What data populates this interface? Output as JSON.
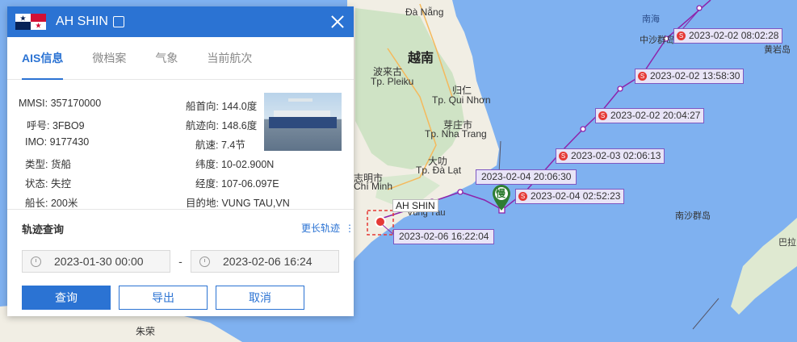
{
  "map": {
    "place_labels": [
      "Đà Nẵng",
      "越南",
      "波来古",
      "Tp. Pleiku",
      "归仁",
      "Tp. Qui Nhơn",
      "芽庄市",
      "Tp. Nha Trang",
      "大叻",
      "Tp. Đà Lạt",
      "志明市",
      "Chí Minh",
      "Vũng Tàu",
      "朱荣",
      "南海",
      "中沙群岛",
      "黄岩岛",
      "南沙群岛",
      "巴拉"
    ],
    "track_points": [
      {
        "time": "2023-02-02 08:02:28"
      },
      {
        "time": "2023-02-02 13:58:30"
      },
      {
        "time": "2023-02-02 20:04:27"
      },
      {
        "time": "2023-02-03 02:06:13"
      },
      {
        "time": "2023-02-04 02:52:23"
      }
    ],
    "plain_labels": [
      "2023-02-04 20:06:30",
      "2023-02-06 16:22:04"
    ],
    "ship_marker_label": "AH SHIN",
    "slow_badge": "慢",
    "colors": {
      "track": "#8e24aa",
      "sea": "#7fb1f0",
      "land": "#f2efe6"
    }
  },
  "panel": {
    "vessel_name": "AH SHIN",
    "icons": {
      "flag": "panama-flag-icon",
      "edit": "edit-icon",
      "close": "close-icon"
    },
    "tabs": [
      "AIS信息",
      "微档案",
      "气象",
      "当前航次"
    ],
    "active_tab": "AIS信息",
    "info_left": [
      {
        "key": "MMSI:",
        "value": "357170000"
      },
      {
        "key": "呼号:",
        "value": "3FBO9"
      },
      {
        "key": "IMO:",
        "value": "9177430"
      },
      {
        "key": "类型:",
        "value": "货船"
      },
      {
        "key": "状态:",
        "value": "失控"
      },
      {
        "key": "船长:",
        "value": "200米"
      }
    ],
    "info_right": [
      {
        "key": "船首向:",
        "value": "144.0度"
      },
      {
        "key": "航迹向:",
        "value": "148.6度"
      },
      {
        "key": "航速:",
        "value": "7.4节"
      },
      {
        "key": "纬度:",
        "value": "10-02.900N"
      },
      {
        "key": "经度:",
        "value": "107-06.097E"
      },
      {
        "key": "目的地:",
        "value": "VUNG TAU,VN"
      }
    ],
    "track": {
      "title": "轨迹查询",
      "more_link": "更长轨迹",
      "start": "2023-01-30 00:00",
      "dash": "-",
      "end": "2023-02-06 16:24",
      "buttons": {
        "query": "查询",
        "export": "导出",
        "cancel": "取消"
      }
    }
  }
}
